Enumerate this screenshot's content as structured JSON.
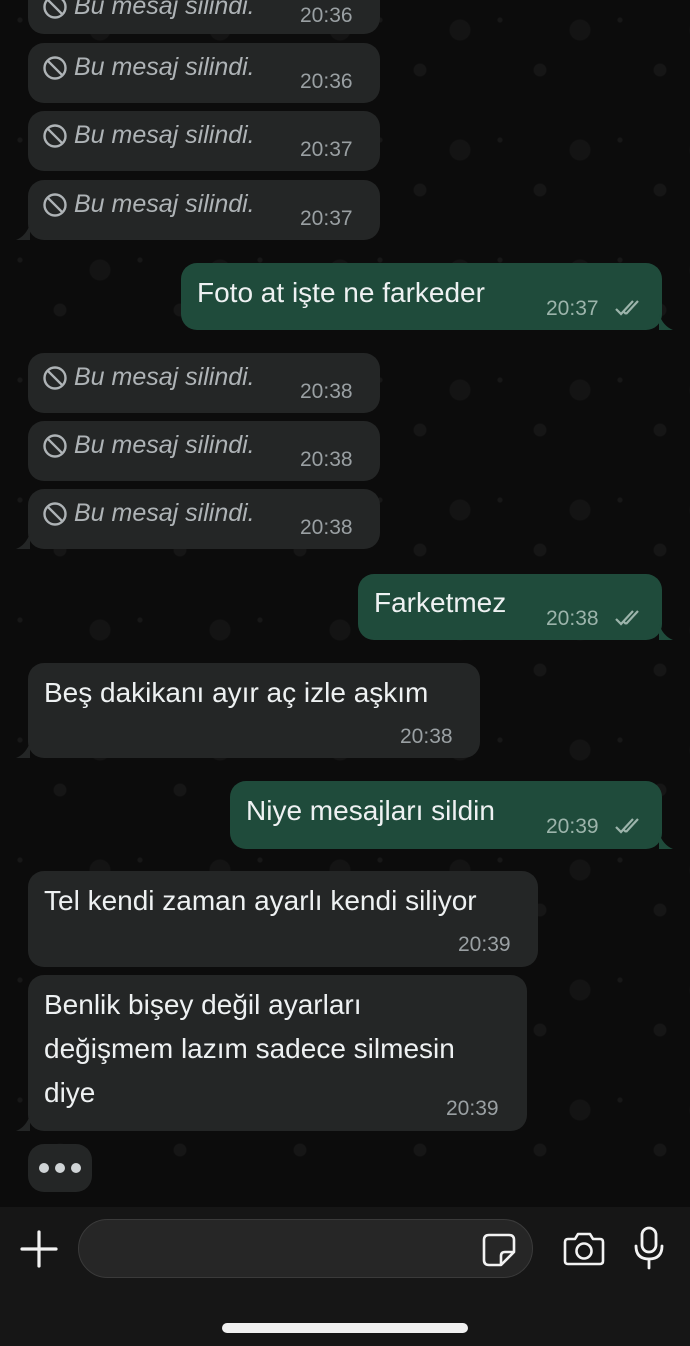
{
  "messages": [
    {
      "type": "in",
      "deleted": true,
      "text": "Bu mesaj silindi.",
      "time": "20:36"
    },
    {
      "type": "in",
      "deleted": true,
      "text": "Bu mesaj silindi.",
      "time": "20:36"
    },
    {
      "type": "in",
      "deleted": true,
      "text": "Bu mesaj silindi.",
      "time": "20:37"
    },
    {
      "type": "in",
      "deleted": true,
      "text": "Bu mesaj silindi.",
      "time": "20:37"
    },
    {
      "type": "out",
      "text": "Foto at işte ne farkeder",
      "time": "20:37",
      "status": "read"
    },
    {
      "type": "in",
      "deleted": true,
      "text": "Bu mesaj silindi.",
      "time": "20:38"
    },
    {
      "type": "in",
      "deleted": true,
      "text": "Bu mesaj silindi.",
      "time": "20:38"
    },
    {
      "type": "in",
      "deleted": true,
      "text": "Bu mesaj silindi.",
      "time": "20:38"
    },
    {
      "type": "out",
      "text": "Farketmez",
      "time": "20:38",
      "status": "read"
    },
    {
      "type": "in",
      "text": "Beş dakikanı ayır aç izle aşkım",
      "time": "20:38"
    },
    {
      "type": "out",
      "text": "Niye mesajları sildin",
      "time": "20:39",
      "status": "read"
    },
    {
      "type": "in",
      "text": "Tel kendi zaman ayarlı kendi siliyor",
      "time": "20:39"
    },
    {
      "type": "in",
      "lines": [
        "Benlik bişey değil ayarları",
        "değişmem lazım sadece silmesin",
        "diye"
      ],
      "time": "20:39"
    }
  ],
  "typing_indicator": "•••",
  "composer": {
    "value": "",
    "placeholder": ""
  },
  "icons": {
    "deleted": "blocked-circle-icon",
    "read": "double-check-icon",
    "attach": "plus-icon",
    "sticker": "sticker-icon",
    "camera": "camera-icon",
    "mic": "microphone-icon"
  },
  "colors": {
    "incoming_bubble": "#242626",
    "outgoing_bubble": "#1f4b3b",
    "background": "#0c0c0c"
  }
}
